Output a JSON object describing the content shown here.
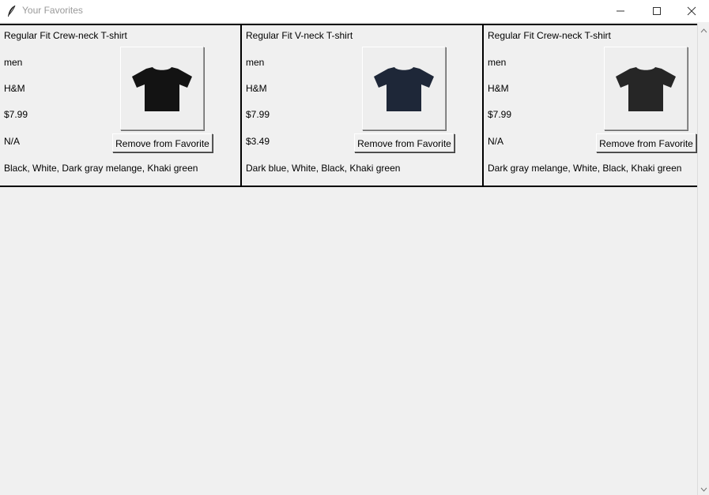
{
  "window": {
    "title": "Your Favorites",
    "icon": "feather-icon",
    "controls": [
      "minimize-icon",
      "maximize-icon",
      "close-icon"
    ]
  },
  "favorites": [
    {
      "name": "Regular Fit Crew-neck T-shirt",
      "gender": "men",
      "brand": "H&M",
      "price": "$7.99",
      "sale_price": "N/A",
      "colors": "Black, White, Dark gray melange, Khaki green",
      "shirt_color": "#131313",
      "remove_label": "Remove from Favorite"
    },
    {
      "name": "Regular Fit V-neck T-shirt",
      "gender": "men",
      "brand": "H&M",
      "price": "$7.99",
      "sale_price": "$3.49",
      "colors": "Dark blue, White, Black, Khaki green",
      "shirt_color": "#1e2738",
      "remove_label": "Remove from Favorite"
    },
    {
      "name": "Regular Fit Crew-neck T-shirt",
      "gender": "men",
      "brand": "H&M",
      "price": "$7.99",
      "sale_price": "N/A",
      "colors": "Dark gray melange, White, Black, Khaki green",
      "shirt_color": "#262626",
      "remove_label": "Remove from Favorite"
    }
  ],
  "scrollbar": {
    "up_icon": "scroll-up-arrow-icon",
    "down_icon": "scroll-down-arrow-icon"
  }
}
